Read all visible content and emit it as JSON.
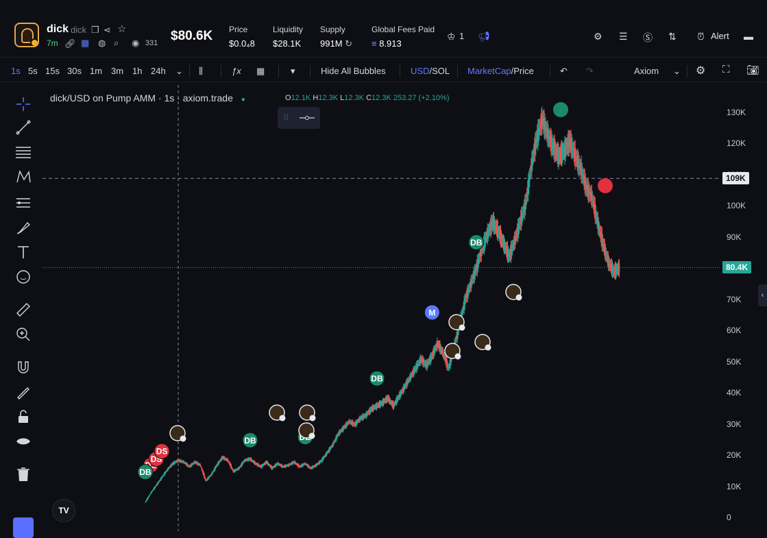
{
  "token": {
    "name": "dick",
    "symbol": "dick",
    "age": "7m",
    "views": "331",
    "market_cap": "$80.6K"
  },
  "stats": [
    {
      "label": "Price",
      "value": "$0.0₄8"
    },
    {
      "label": "Liquidity",
      "value": "$28.1K"
    },
    {
      "label": "Supply",
      "value": "991M"
    },
    {
      "label": "Global Fees Paid",
      "value": "8.913"
    }
  ],
  "header_right": {
    "crown_count": "1",
    "alert_label": "Alert"
  },
  "toolbar": {
    "intervals": [
      "1s",
      "5s",
      "15s",
      "30s",
      "1m",
      "3m",
      "1h",
      "24h"
    ],
    "active_interval": "1s",
    "hide_bubbles": "Hide All Bubbles",
    "usd": "USD",
    "sol": "/SOL",
    "marketcap": "MarketCap",
    "price": "/Price",
    "provider": "Axiom"
  },
  "legend": {
    "title": "dick/USD on Pump AMM · 1s · axiom.trade",
    "o_label": "O",
    "o": "12.1K",
    "h_label": "H",
    "h": "12.3K",
    "l_label": "L",
    "l": "12.3K",
    "c_label": "C",
    "c": "12.3K",
    "change": "253.27 (+2.10%)"
  },
  "colors": {
    "up": "#26a69a",
    "down": "#ef5350",
    "accent": "#5a7bff",
    "badge_green": "#1b8a6b",
    "badge_red": "#e0313e"
  },
  "chart_data": {
    "type": "line",
    "ylim": [
      0,
      135000
    ],
    "yticks": [
      "130K",
      "120K",
      "110K",
      "100K",
      "90K",
      "80K",
      "70K",
      "60K",
      "50K",
      "40K",
      "30K",
      "20K",
      "10K",
      "0"
    ],
    "ytick_values": [
      130000,
      120000,
      110000,
      100000,
      90000,
      80000,
      70000,
      60000,
      50000,
      40000,
      30000,
      20000,
      10000,
      0
    ],
    "crosshair_value": 109000,
    "crosshair_label": "109K",
    "current_value": 80400,
    "current_label": "80.4K",
    "series": [
      {
        "values": [
          5000,
          8000,
          10500,
          13000,
          15500,
          17500,
          18500,
          18000,
          16500,
          18000,
          17000,
          12000,
          14000,
          17000,
          19500,
          18500,
          15000,
          16000,
          18500,
          19000,
          17500,
          16500,
          18000,
          16000,
          17500,
          16500,
          17000,
          18000,
          16500,
          17500,
          16000,
          17000,
          18500,
          21000,
          23500,
          27000,
          29000,
          31000,
          30000,
          32000,
          33000,
          35000,
          36000,
          37000,
          38500,
          36000,
          39000,
          42000,
          45000,
          48000,
          51000,
          49000,
          52000,
          56000,
          53000,
          48000,
          55000,
          62000,
          70000,
          75000,
          80000,
          86000,
          91000,
          95000,
          92000,
          88000,
          84000,
          89000,
          95000,
          101000,
          113000,
          122000,
          128000,
          123000,
          119000,
          116000,
          118000,
          121000,
          116000,
          112000,
          106000,
          103000,
          95000,
          88000,
          82000,
          79000,
          80400
        ]
      }
    ],
    "markers": [
      {
        "label": "DS",
        "color": "red",
        "x_index": 1,
        "value": 17000
      },
      {
        "label": "DS",
        "color": "red",
        "x_index": 2,
        "value": 19000
      },
      {
        "label": "DS",
        "color": "red",
        "x_index": 3,
        "value": 21500
      },
      {
        "label": "DB",
        "color": "green",
        "x_index": 0,
        "value": 14800
      },
      {
        "label": "DB",
        "color": "green",
        "x_index": 19,
        "value": 25000
      },
      {
        "label": "DB",
        "color": "green",
        "x_index": 29,
        "value": 26000
      },
      {
        "label": "DB",
        "color": "green",
        "x_index": 42,
        "value": 44800
      },
      {
        "label": "M",
        "color": "blue",
        "x_index": 52,
        "value": 66000
      },
      {
        "label": "DB",
        "color": "green",
        "x_index": 60,
        "value": 88500
      }
    ]
  }
}
